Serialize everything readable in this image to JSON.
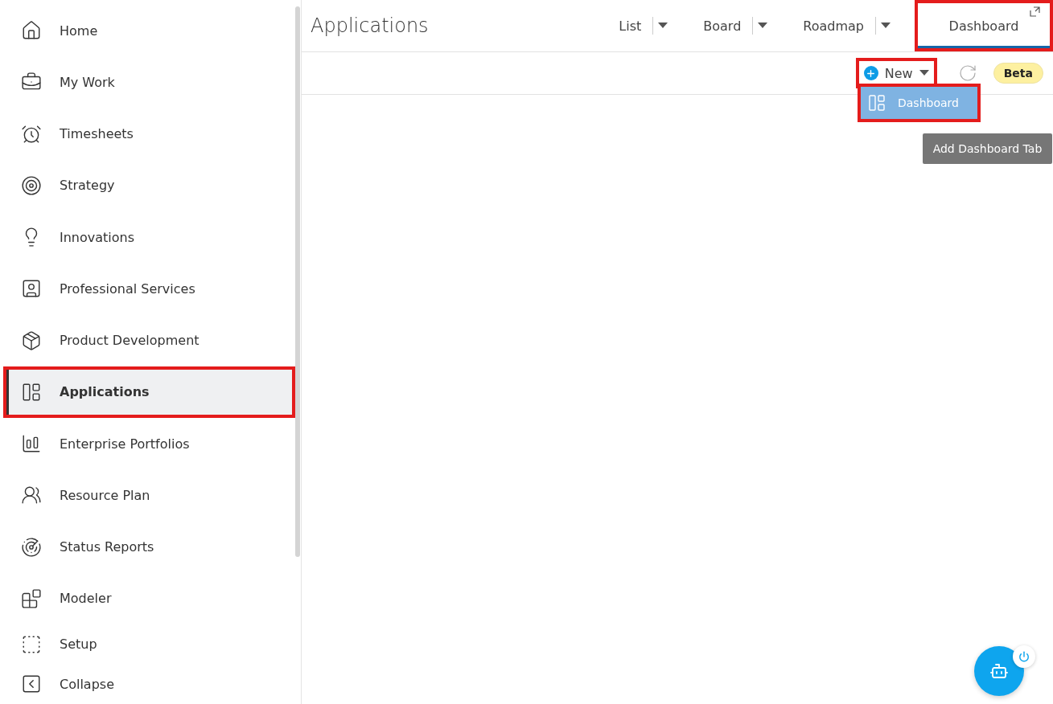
{
  "sidebar": {
    "items": [
      {
        "label": "Home",
        "selected": false,
        "highlighted": false
      },
      {
        "label": "My Work",
        "selected": false,
        "highlighted": false
      },
      {
        "label": "Timesheets",
        "selected": false,
        "highlighted": false
      },
      {
        "label": "Strategy",
        "selected": false,
        "highlighted": false
      },
      {
        "label": "Innovations",
        "selected": false,
        "highlighted": false
      },
      {
        "label": "Professional Services",
        "selected": false,
        "highlighted": false
      },
      {
        "label": "Product Development",
        "selected": false,
        "highlighted": false
      },
      {
        "label": "Applications",
        "selected": true,
        "highlighted": true
      },
      {
        "label": "Enterprise Portfolios",
        "selected": false,
        "highlighted": false
      },
      {
        "label": "Resource Plan",
        "selected": false,
        "highlighted": false
      },
      {
        "label": "Status Reports",
        "selected": false,
        "highlighted": false
      },
      {
        "label": "Modeler",
        "selected": false,
        "highlighted": false
      }
    ],
    "footer_items": [
      {
        "label": "Setup"
      },
      {
        "label": "Collapse"
      }
    ]
  },
  "header": {
    "title": "Applications",
    "tabs": [
      {
        "label": "List",
        "selected": false,
        "highlighted": false,
        "has_menu": true
      },
      {
        "label": "Board",
        "selected": false,
        "highlighted": false,
        "has_menu": true
      },
      {
        "label": "Roadmap",
        "selected": false,
        "highlighted": false,
        "has_menu": true
      },
      {
        "label": "Dashboard",
        "selected": true,
        "highlighted": true,
        "has_menu": false
      }
    ]
  },
  "toolbar": {
    "new_button": {
      "label": "New",
      "highlighted": true
    },
    "badge": "Beta"
  },
  "new_menu": {
    "items": [
      {
        "label": "Dashboard",
        "selected": true,
        "highlighted": true
      }
    ]
  },
  "tooltip": "Add Dashboard Tab"
}
